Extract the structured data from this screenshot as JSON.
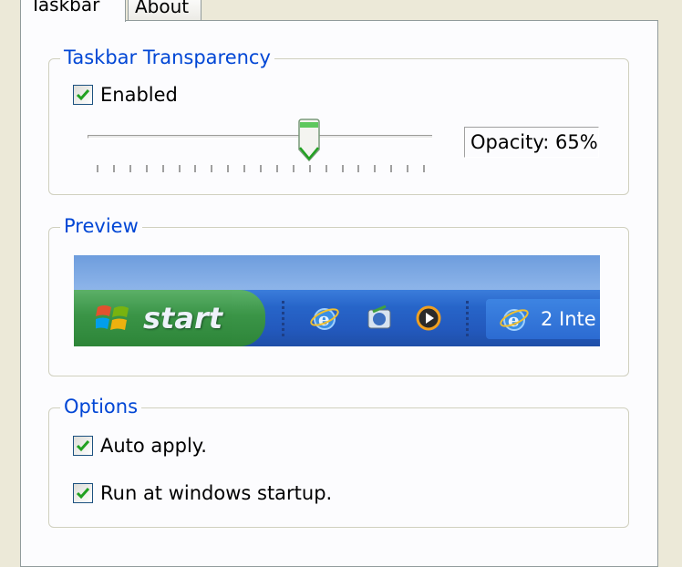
{
  "tabs": [
    {
      "label": "Taskbar"
    },
    {
      "label": "About"
    }
  ],
  "transparency": {
    "legend": "Taskbar Transparency",
    "enabled_label": "Enabled",
    "enabled_checked": true,
    "slider_value_fraction": 0.65,
    "opacity_text": "Opacity: 65%"
  },
  "preview": {
    "legend": "Preview",
    "start_label": "start",
    "task_label": "2 Inte",
    "icons": [
      "windows-logo-icon",
      "ie-icon",
      "outlook-express-icon",
      "media-player-icon",
      "ie-icon"
    ]
  },
  "options": {
    "legend": "Options",
    "auto_apply_label": "Auto apply.",
    "auto_apply_checked": true,
    "startup_label": "Run at windows startup.",
    "startup_checked": true
  },
  "colors": {
    "legend_blue": "#0046d5",
    "check_green": "#21a121",
    "tab_highlight": "#ffc83c"
  }
}
